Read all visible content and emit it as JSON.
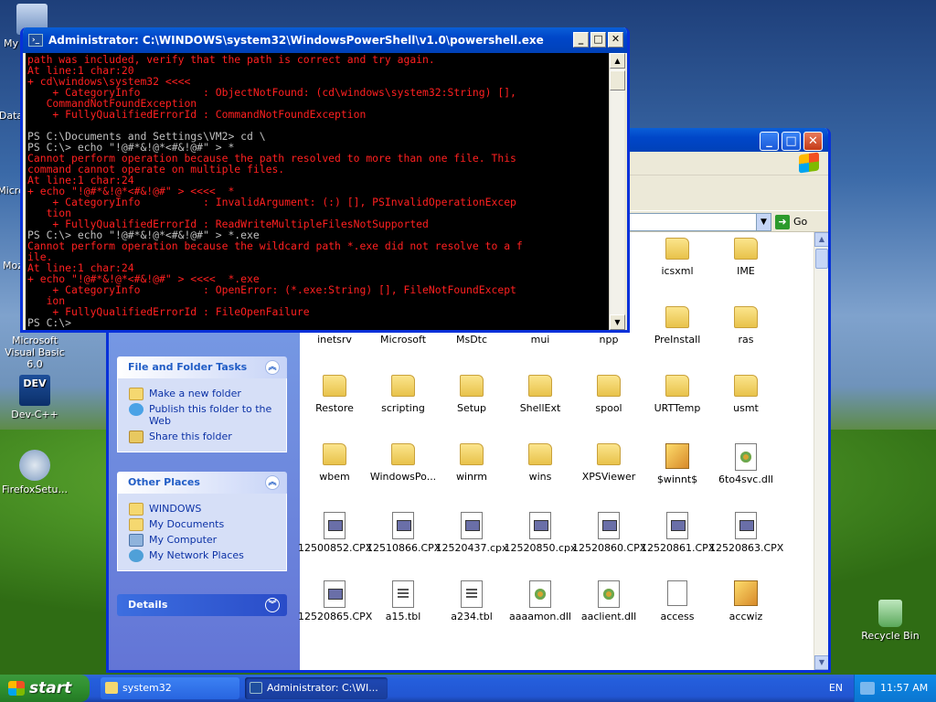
{
  "desktop": {
    "icons": [
      {
        "label": "My",
        "icon": "my-computer-icon"
      },
      {
        "label": "Data",
        "icon": "data-icon"
      },
      {
        "label": "Micro",
        "icon": "micro-icon"
      },
      {
        "label": "Moz",
        "icon": "mozilla-icon"
      },
      {
        "label": "Microsoft Visual Basic 6.0",
        "icon": "visual-basic-icon"
      },
      {
        "label": "Dev-C++",
        "icon": "dev-cpp-icon"
      },
      {
        "label": "FirefoxSetu...",
        "icon": "setup-icon"
      },
      {
        "label": "Recycle Bin",
        "icon": "recycle-bin-icon"
      }
    ]
  },
  "powershell": {
    "title": "Administrator: C:\\WINDOWS\\system32\\WindowsPowerShell\\v1.0\\powershell.exe",
    "lines": [
      {
        "t": "path was included, verify that the path is correct and try again.",
        "c": "err"
      },
      {
        "t": "At line:1 char:20",
        "c": "err"
      },
      {
        "t": "+ cd\\windows\\system32 <<<<",
        "c": "err"
      },
      {
        "t": "    + CategoryInfo          : ObjectNotFound: (cd\\windows\\system32:String) [],",
        "c": "err"
      },
      {
        "t": "   CommandNotFoundException",
        "c": "err"
      },
      {
        "t": "    + FullyQualifiedErrorId : CommandNotFoundException",
        "c": "err"
      },
      {
        "t": "",
        "c": "out"
      },
      {
        "t": "PS C:\\Documents and Settings\\VM2> cd \\",
        "c": "out"
      },
      {
        "t": "PS C:\\> echo \"!@#*&!@*<#&!@#\" > *",
        "c": "out"
      },
      {
        "t": "Cannot perform operation because the path resolved to more than one file. This",
        "c": "err"
      },
      {
        "t": "command cannot operate on multiple files.",
        "c": "err"
      },
      {
        "t": "At line:1 char:24",
        "c": "err"
      },
      {
        "t": "+ echo \"!@#*&!@*<#&!@#\" > <<<<  *",
        "c": "err"
      },
      {
        "t": "    + CategoryInfo          : InvalidArgument: (:) [], PSInvalidOperationExcep",
        "c": "err"
      },
      {
        "t": "   tion",
        "c": "err"
      },
      {
        "t": "    + FullyQualifiedErrorId : ReadWriteMultipleFilesNotSupported",
        "c": "err"
      },
      {
        "t": "PS C:\\> echo \"!@#*&!@*<#&!@#\" > *.exe",
        "c": "out"
      },
      {
        "t": "Cannot perform operation because the wildcard path *.exe did not resolve to a f",
        "c": "err"
      },
      {
        "t": "ile.",
        "c": "err"
      },
      {
        "t": "At line:1 char:24",
        "c": "err"
      },
      {
        "t": "+ echo \"!@#*&!@*<#&!@#\" > <<<<  *.exe",
        "c": "err"
      },
      {
        "t": "    + CategoryInfo          : OpenError: (*.exe:String) [], FileNotFoundExcept",
        "c": "err"
      },
      {
        "t": "   ion",
        "c": "err"
      },
      {
        "t": "    + FullyQualifiedErrorId : FileOpenFailure",
        "c": "err"
      },
      {
        "t": "PS C:\\>",
        "c": "out"
      }
    ]
  },
  "explorer": {
    "go_label": "Go",
    "file_tasks": {
      "title": "File and Folder Tasks",
      "items": [
        "Make a new folder",
        "Publish this folder to the Web",
        "Share this folder"
      ]
    },
    "other_places": {
      "title": "Other Places",
      "items": [
        "WINDOWS",
        "My Documents",
        "My Computer",
        "My Network Places"
      ]
    },
    "details_title": "Details",
    "files": [
      {
        "name": "icsxml",
        "type": "folder"
      },
      {
        "name": "IME",
        "type": "folder"
      },
      {
        "name": "inetsrv",
        "type": "folder"
      },
      {
        "name": "Microsoft",
        "type": "folder"
      },
      {
        "name": "MsDtc",
        "type": "folder"
      },
      {
        "name": "mui",
        "type": "folder"
      },
      {
        "name": "npp",
        "type": "folder"
      },
      {
        "name": "PreInstall",
        "type": "folder"
      },
      {
        "name": "ras",
        "type": "folder"
      },
      {
        "name": "Restore",
        "type": "folder"
      },
      {
        "name": "scripting",
        "type": "folder"
      },
      {
        "name": "Setup",
        "type": "folder"
      },
      {
        "name": "ShellExt",
        "type": "folder"
      },
      {
        "name": "spool",
        "type": "folder"
      },
      {
        "name": "URTTemp",
        "type": "folder"
      },
      {
        "name": "usmt",
        "type": "folder"
      },
      {
        "name": "wbem",
        "type": "folder"
      },
      {
        "name": "WindowsPo...",
        "type": "folder"
      },
      {
        "name": "winrm",
        "type": "folder"
      },
      {
        "name": "wins",
        "type": "folder"
      },
      {
        "name": "XPSViewer",
        "type": "folder"
      },
      {
        "name": "$winnt$",
        "type": "wiz"
      },
      {
        "name": "6to4svc.dll",
        "type": "dll"
      },
      {
        "name": "12500852.CPX",
        "type": "cpx"
      },
      {
        "name": "12510866.CPX",
        "type": "cpx"
      },
      {
        "name": "12520437.cpx",
        "type": "cpx"
      },
      {
        "name": "12520850.cpx",
        "type": "cpx"
      },
      {
        "name": "12520860.CPX",
        "type": "cpx"
      },
      {
        "name": "12520861.CPX",
        "type": "cpx"
      },
      {
        "name": "12520863.CPX",
        "type": "cpx"
      },
      {
        "name": "12520865.CPX",
        "type": "cpx"
      },
      {
        "name": "a15.tbl",
        "type": "tbl"
      },
      {
        "name": "a234.tbl",
        "type": "tbl"
      },
      {
        "name": "aaaamon.dll",
        "type": "dll"
      },
      {
        "name": "aaclient.dll",
        "type": "dll"
      },
      {
        "name": "access",
        "type": "acc"
      },
      {
        "name": "accwiz",
        "type": "wiz"
      }
    ]
  },
  "taskbar": {
    "start_label": "start",
    "tasks": [
      {
        "label": "system32",
        "active": false
      },
      {
        "label": "Administrator: C:\\WI...",
        "active": true
      }
    ],
    "language": "EN",
    "clock": "11:57 AM"
  }
}
